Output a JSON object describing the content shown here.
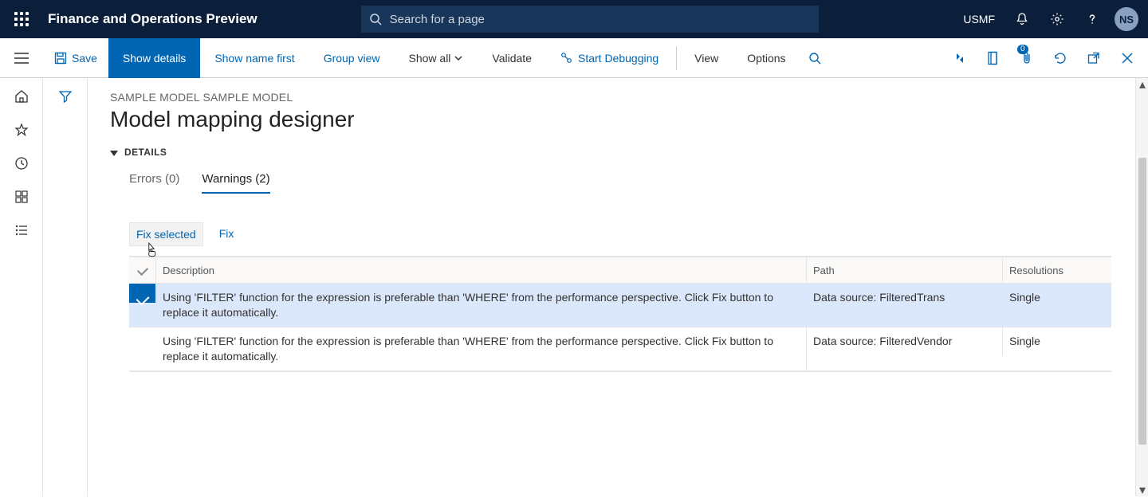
{
  "topbar": {
    "title": "Finance and Operations Preview",
    "search_placeholder": "Search for a page",
    "legal_entity": "USMF",
    "avatar_initials": "NS"
  },
  "actionbar": {
    "save": "Save",
    "show_details": "Show details",
    "show_name_first": "Show name first",
    "group_view": "Group view",
    "show_all": "Show all",
    "validate": "Validate",
    "start_debugging": "Start Debugging",
    "view": "View",
    "options": "Options",
    "attachments_badge": "0"
  },
  "content": {
    "breadcrumb": "SAMPLE MODEL SAMPLE MODEL",
    "title": "Model mapping designer",
    "section": "DETAILS"
  },
  "tabs": {
    "errors": "Errors (0)",
    "warnings": "Warnings (2)"
  },
  "buttons": {
    "fix_selected": "Fix selected",
    "fix": "Fix"
  },
  "table": {
    "headers": {
      "description": "Description",
      "path": "Path",
      "resolutions": "Resolutions"
    },
    "rows": [
      {
        "selected": true,
        "description": "Using 'FILTER' function for the expression is preferable than 'WHERE' from the performance perspective. Click Fix button to replace it automatically.",
        "path": "Data source: FilteredTrans",
        "resolutions": "Single"
      },
      {
        "selected": false,
        "description": "Using 'FILTER' function for the expression is preferable than 'WHERE' from the performance perspective. Click Fix button to replace it automatically.",
        "path": "Data source: FilteredVendor",
        "resolutions": "Single"
      }
    ]
  }
}
